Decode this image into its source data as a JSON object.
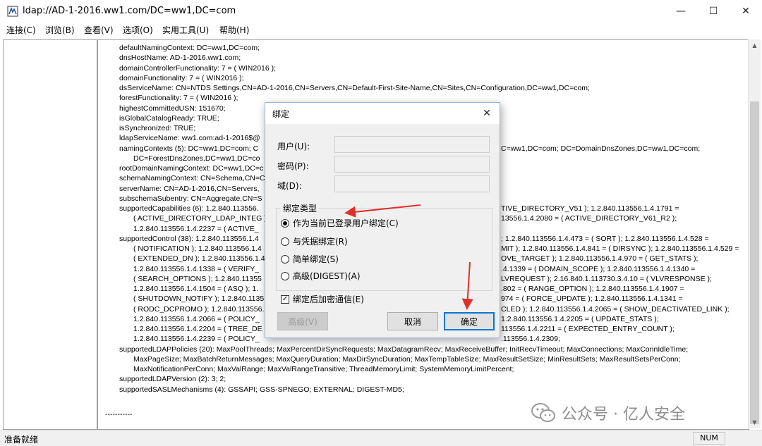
{
  "window": {
    "title": "ldap://AD-1-2016.ww1.com/DC=ww1,DC=com",
    "minimize": "—",
    "maximize": "☐",
    "close": "✕"
  },
  "menu": [
    "连接(C)",
    "浏览(B)",
    "查看(V)",
    "选项(O)",
    "实用工具(U)",
    "帮助(H)"
  ],
  "output_lines": [
    {
      "t": "defaultNamingContext: DC=ww1,DC=com;",
      "i": 0
    },
    {
      "t": "dnsHostName: AD-1-2016.ww1.com;",
      "i": 0
    },
    {
      "t": "domainControllerFunctionality: 7 = ( WIN2016 );",
      "i": 0
    },
    {
      "t": "domainFunctionality: 7 = ( WIN2016 );",
      "i": 0
    },
    {
      "t": "dsServiceName: CN=NTDS Settings,CN=AD-1-2016,CN=Servers,CN=Default-First-Site-Name,CN=Sites,CN=Configuration,DC=ww1,DC=com;",
      "i": 0
    },
    {
      "t": "forestFunctionality: 7 = ( WIN2016 );",
      "i": 0
    },
    {
      "t": "highestCommittedUSN: 151670;",
      "i": 0
    },
    {
      "t": "isGlobalCatalogReady: TRUE;",
      "i": 0
    },
    {
      "t": "isSynchronized: TRUE;",
      "i": 0
    },
    {
      "t": "ldapServiceName: ww1.com:ad-1-2016$@",
      "i": 0
    },
    {
      "t": "namingContexts (5): DC=ww1,DC=com; C",
      "i": 0,
      "r": "C=ww1,DC=com; DC=DomainDnsZones,DC=ww1,DC=com;"
    },
    {
      "t": "DC=ForestDnsZones,DC=ww1,DC=co",
      "i": 1
    },
    {
      "t": "rootDomainNamingContext: DC=ww1,DC=c",
      "i": 0
    },
    {
      "t": "schemaNamingContext: CN=Schema,CN=C",
      "i": 0
    },
    {
      "t": "serverName: CN=AD-1-2016,CN=Servers,",
      "i": 0
    },
    {
      "t": "subschemaSubentry: CN=Aggregate,CN=S",
      "i": 0
    },
    {
      "t": "supportedCapabilities (6): 1.2.840.113556.",
      "i": 0,
      "r": "TIVE_DIRECTORY_V51 ); 1.2.840.113556.1.4.1791 ="
    },
    {
      "t": "( ACTIVE_DIRECTORY_LDAP_INTEG );",
      "i": 1,
      "r": "13556.1.4.2080 = ( ACTIVE_DIRECTORY_V61_R2 );"
    },
    {
      "t": "1.2.840.113556.1.4.2237 = ( ACTIVE_",
      "i": 1
    },
    {
      "t": "supportedControl (38): 1.2.840.113556.1.4",
      "i": 0,
      "r": "; 1.2.840.113556.1.4.473 = ( SORT ); 1.2.840.113556.1.4.528 ="
    },
    {
      "t": "( NOTIFICATION ); 1.2.840.113556.1.4",
      "i": 1,
      "r": "MIT ); 1.2.840.113556.1.4.841 = ( DIRSYNC ); 1.2.840.113556.1.4.529 ="
    },
    {
      "t": "( EXTENDED_DN ); 1.2.840.113556.1.4",
      "i": 1,
      "r": "OVE_TARGET ); 1.2.840.113556.1.4.970 = ( GET_STATS );"
    },
    {
      "t": "1.2.840.113556.1.4.1338 = ( VERIFY_",
      "i": 1,
      "r": ".4.1339 = ( DOMAIN_SCOPE ); 1.2.840.113556.1.4.1340 ="
    },
    {
      "t": "( SEARCH_OPTIONS ); 1.2.840.11355",
      "i": 1,
      "r": "LVREQUEST ); 2.16.840.1.113730.3.4.10 = ( VLVRESPONSE );"
    },
    {
      "t": "1.2.840.113556.1.4.1504 = ( ASQ ); 1.",
      "i": 1,
      "r": ".802 = ( RANGE_OPTION ); 1.2.840.113556.1.4.1907 ="
    },
    {
      "t": "( SHUTDOWN_NOTIFY ); 1.2.840.1135",
      "i": 1,
      "r": "974 = ( FORCE_UPDATE ); 1.2.840.113556.1.4.1341 ="
    },
    {
      "t": "( RODC_DCPROMO ); 1.2.840.113556.",
      "i": 1,
      "r": "CLED ); 1.2.840.113556.1.4.2065 = ( SHOW_DEACTIVATED_LINK );"
    },
    {
      "t": "1.2.840.113556.1.4.2066 = ( POLICY_",
      "i": 1,
      "r": "1.2.840.113556.1.4.2205 = ( UPDATE_STATS );"
    },
    {
      "t": "1.2.840.113556.1.4.2204 = ( TREE_DE",
      "i": 1,
      "r": "113556.1.4.2211 = ( EXPECTED_ENTRY_COUNT );"
    },
    {
      "t": "1.2.840.113556.1.4.2239 = ( POLICY_",
      "i": 1,
      "r": ".113556.1.4.2309;"
    },
    {
      "t": "supportedLDAPPolicies (20): MaxPoolThreads; MaxPercentDirSyncRequests; MaxDatagramRecv; MaxReceiveBuffer; InitRecvTimeout; MaxConnections; MaxConnIdleTime;",
      "i": 0
    },
    {
      "t": "MaxPageSize; MaxBatchReturnMessages; MaxQueryDuration; MaxDirSyncDuration; MaxTempTableSize; MaxResultSetSize; MinResultSets; MaxResultSetsPerConn;",
      "i": 1
    },
    {
      "t": "MaxNotificationPerConn; MaxValRange; MaxValRangeTransitive; ThreadMemoryLimit; SystemMemoryLimitPercent;",
      "i": 1
    },
    {
      "t": "supportedLDAPVersion (2): 3; 2;",
      "i": 0
    },
    {
      "t": "supportedSASLMechanisms (4): GSSAPI; GSS-SPNEGO; EXTERNAL; DIGEST-MD5;",
      "i": 0
    }
  ],
  "separator": "-----------",
  "status": {
    "text": "准备就绪",
    "num": "NUM"
  },
  "watermark": "公众号 · 亿人安全",
  "dialog": {
    "title": "绑定",
    "user_label": "用户(U):",
    "password_label": "密码(P):",
    "domain_label": "域(D):",
    "user_value": "",
    "password_value": "",
    "domain_value": "",
    "group_title": "绑定类型",
    "radios": [
      {
        "label": "作为当前已登录用户绑定(C)",
        "checked": true
      },
      {
        "label": "与凭据绑定(R)",
        "checked": false
      },
      {
        "label": "简单绑定(S)",
        "checked": false
      },
      {
        "label": "高级(DIGEST)(A)",
        "checked": false
      }
    ],
    "encrypt_label": "绑定后加密通信(E)",
    "encrypt_checked": true,
    "advanced_btn": "高级(V)",
    "cancel_btn": "取消",
    "ok_btn": "确定"
  },
  "colors": {
    "annotation_arrow": "#e0302a",
    "ok_focus": "#0078d7"
  }
}
